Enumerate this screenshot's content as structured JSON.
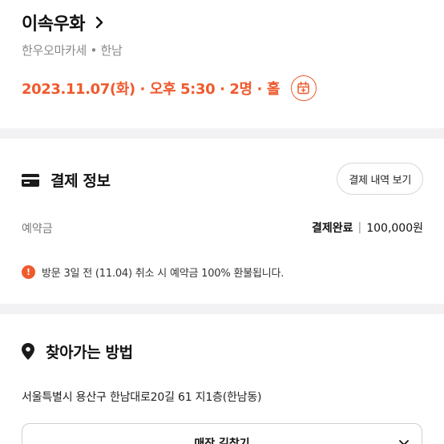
{
  "restaurant": {
    "name": "이속우화",
    "category_location": "한우오마카세 • 한남",
    "booking_summary": "2023.11.07(화) · 오후 5:30 · 2명 · 홀",
    "accent_color": "#ef5a2d",
    "icons": {
      "name_link": "chevron-right-icon",
      "calendar": "calendar-add-icon"
    }
  },
  "payment": {
    "title": "결제 정보",
    "history_button": "결제 내역 보기",
    "deposit_label": "예약금",
    "deposit_status": "결제완료",
    "deposit_separator": "|",
    "deposit_amount": "100,000원",
    "notice": "방문 3일 전 (11.04) 취소 시 예약금 100% 환불됩니다.",
    "icons": {
      "title": "card-icon",
      "notice": "info-icon"
    }
  },
  "directions": {
    "title": "찾아가는 방법",
    "address": "서울특별시 용산구 한남대로20길 61 지1층(한남동)",
    "route_button": "매장 길찾기",
    "icons": {
      "title": "location-pin-icon",
      "route": "chevron-down-icon"
    }
  }
}
